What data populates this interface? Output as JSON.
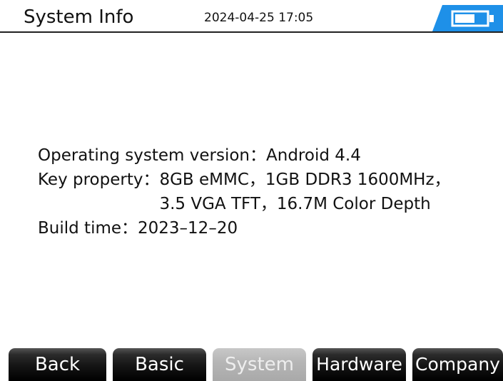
{
  "header": {
    "title": "System Info",
    "datetime": "2024-04-25 17:05",
    "battery_icon": "battery-icon",
    "battery_level": 0.6
  },
  "info": {
    "os_label": "Operating system version",
    "os_value": "Android 4.4",
    "key_label": "Key property",
    "key_value_line1": "8GB eMMC，1GB DDR3 1600MHz，",
    "key_value_line2": "3.5 VGA TFT，16.7M Color Depth",
    "build_label": "Build time",
    "build_value": "2023–12–20",
    "separator": "："
  },
  "tabs": [
    {
      "label": "Back",
      "active": false
    },
    {
      "label": "Basic",
      "active": false
    },
    {
      "label": "System",
      "active": true
    },
    {
      "label": "Hardware",
      "active": false
    },
    {
      "label": "Company",
      "active": false
    }
  ],
  "colors": {
    "battery_blue": "#1e90e8",
    "active_button": "#b6b6b6",
    "inactive_button": "#141414"
  }
}
